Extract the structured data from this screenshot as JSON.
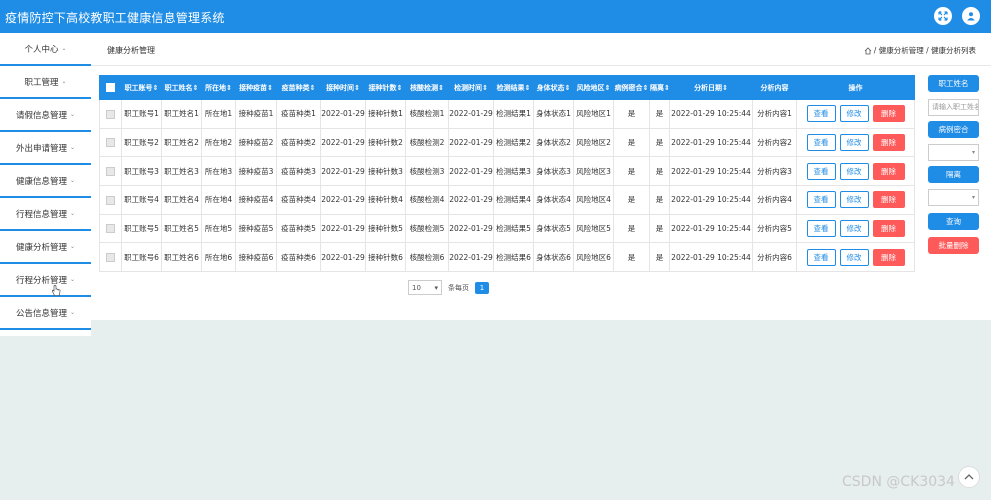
{
  "app": {
    "title": "疫情防控下高校教职工健康信息管理系统"
  },
  "sidebar": {
    "items": [
      {
        "label": "个人中心"
      },
      {
        "label": "职工管理"
      },
      {
        "label": "请假信息管理"
      },
      {
        "label": "外出申请管理"
      },
      {
        "label": "健康信息管理"
      },
      {
        "label": "行程信息管理"
      },
      {
        "label": "健康分析管理"
      },
      {
        "label": "行程分析管理"
      },
      {
        "label": "公告信息管理"
      }
    ]
  },
  "header": {
    "page_title": "健康分析管理",
    "breadcrumb": "/ 健康分析管理 / 健康分析列表"
  },
  "table": {
    "headers": [
      "职工账号",
      "职工姓名",
      "所在地",
      "接种疫苗",
      "疫苗种类",
      "接种时间",
      "接种针数",
      "核酸检测",
      "检测时间",
      "检测结果",
      "身体状态",
      "风险地区",
      "病例密合",
      "隔离",
      "分析日期",
      "分析内容",
      "操作"
    ],
    "rows": [
      [
        "职工账号1",
        "职工姓名1",
        "所在地1",
        "接种疫苗1",
        "疫苗种类1",
        "2022-01-29",
        "接种针数1",
        "核酸检测1",
        "2022-01-29",
        "检测结果1",
        "身体状态1",
        "风险地区1",
        "是",
        "是",
        "2022-01-29 10:25:44",
        "分析内容1"
      ],
      [
        "职工账号2",
        "职工姓名2",
        "所在地2",
        "接种疫苗2",
        "疫苗种类2",
        "2022-01-29",
        "接种针数2",
        "核酸检测2",
        "2022-01-29",
        "检测结果2",
        "身体状态2",
        "风险地区2",
        "是",
        "是",
        "2022-01-29 10:25:44",
        "分析内容2"
      ],
      [
        "职工账号3",
        "职工姓名3",
        "所在地3",
        "接种疫苗3",
        "疫苗种类3",
        "2022-01-29",
        "接种针数3",
        "核酸检测3",
        "2022-01-29",
        "检测结果3",
        "身体状态3",
        "风险地区3",
        "是",
        "是",
        "2022-01-29 10:25:44",
        "分析内容3"
      ],
      [
        "职工账号4",
        "职工姓名4",
        "所在地4",
        "接种疫苗4",
        "疫苗种类4",
        "2022-01-29",
        "接种针数4",
        "核酸检测4",
        "2022-01-29",
        "检测结果4",
        "身体状态4",
        "风险地区4",
        "是",
        "是",
        "2022-01-29 10:25:44",
        "分析内容4"
      ],
      [
        "职工账号5",
        "职工姓名5",
        "所在地5",
        "接种疫苗5",
        "疫苗种类5",
        "2022-01-29",
        "接种针数5",
        "核酸检测5",
        "2022-01-29",
        "检测结果5",
        "身体状态5",
        "风险地区5",
        "是",
        "是",
        "2022-01-29 10:25:44",
        "分析内容5"
      ],
      [
        "职工账号6",
        "职工姓名6",
        "所在地6",
        "接种疫苗6",
        "疫苗种类6",
        "2022-01-29",
        "接种针数6",
        "核酸检测6",
        "2022-01-29",
        "检测结果6",
        "身体状态6",
        "风险地区6",
        "是",
        "是",
        "2022-01-29 10:25:44",
        "分析内容6"
      ]
    ],
    "view_label": "查看",
    "edit_label": "修改",
    "delete_label": "删除"
  },
  "pager": {
    "page_size": "10",
    "per_page_label": "条每页",
    "current_page": "1"
  },
  "search_panel": {
    "name_label": "职工姓名",
    "name_placeholder": "请输入职工姓名",
    "close_contact_label": "病例密合",
    "isolation_label": "隔离",
    "search_label": "查询",
    "batch_delete_label": "批量删除"
  },
  "watermark": "CSDN @CK3034",
  "colors": {
    "primary": "#1f8ce6",
    "danger": "#ff5a5a",
    "background": "#e6efed"
  }
}
